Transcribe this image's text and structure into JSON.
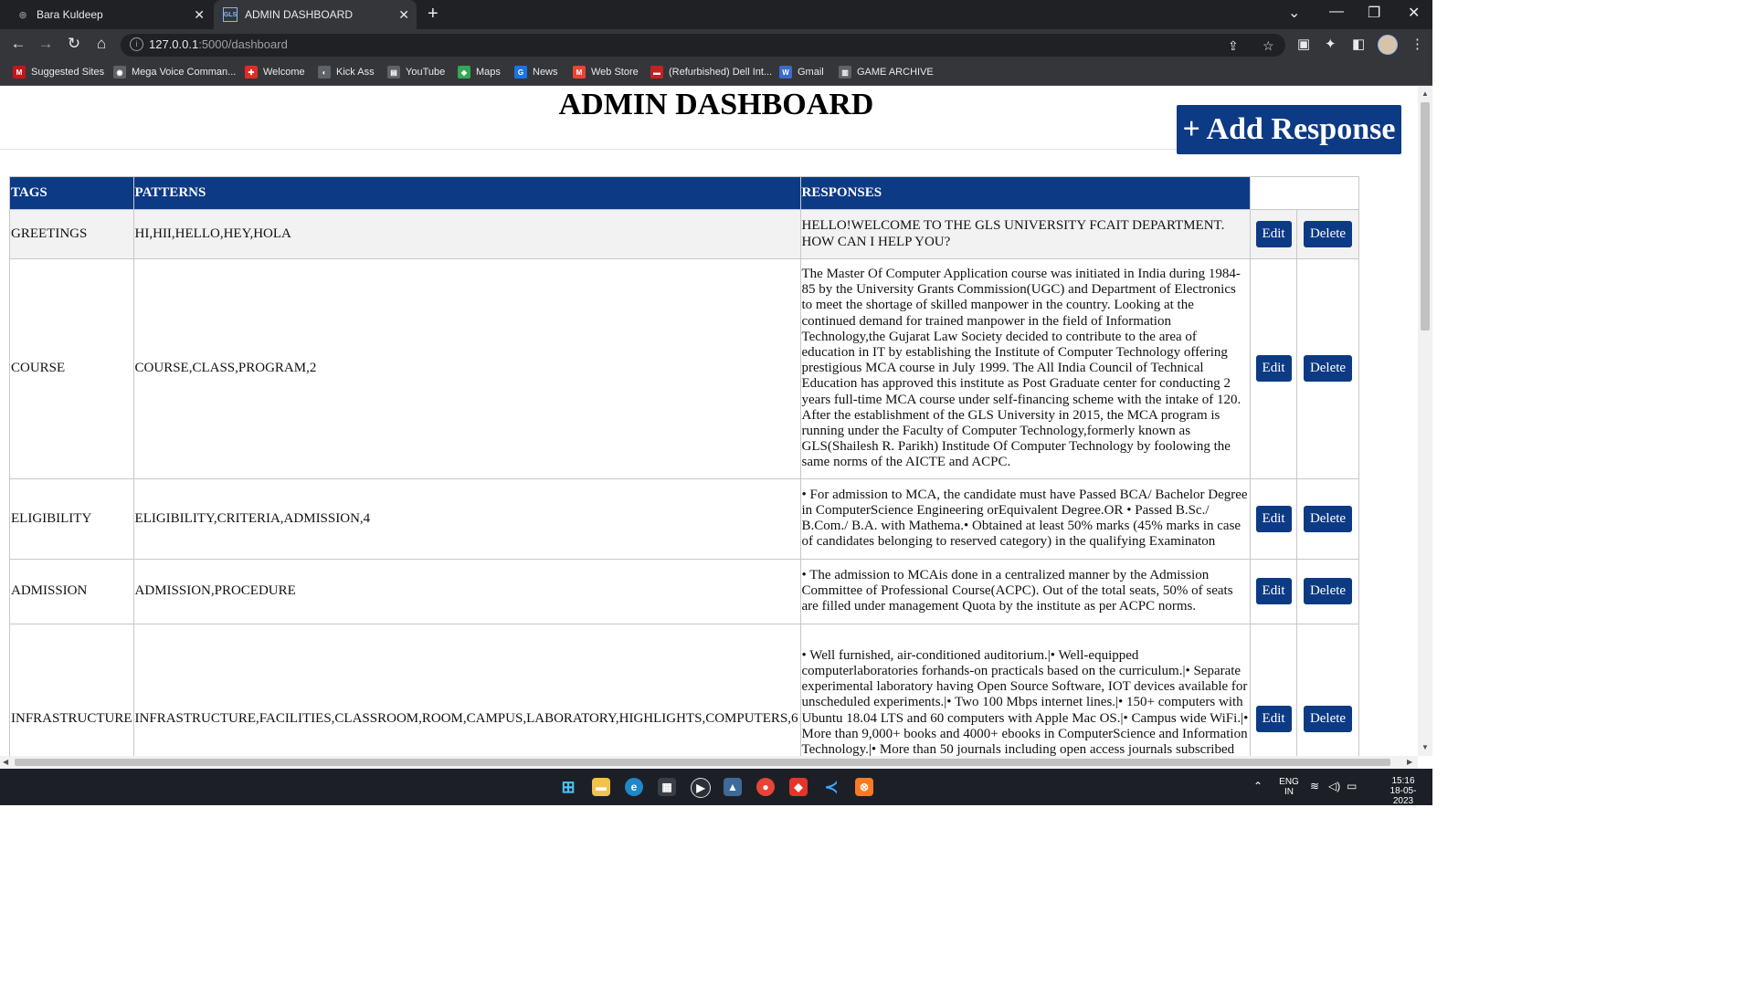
{
  "browser": {
    "tabs": [
      {
        "title": "Bara Kuldeep",
        "active": false
      },
      {
        "title": "ADMIN DASHBOARD",
        "active": true,
        "favicon": "GLS"
      }
    ],
    "url": {
      "host": "127.0.0.1",
      "rest": ":5000/dashboard"
    },
    "bookmarks": [
      {
        "label": "Suggested Sites",
        "icon": "M",
        "color": "#c4161c"
      },
      {
        "label": "Mega Voice Comman...",
        "icon": "◉",
        "color": "#5f6368"
      },
      {
        "label": "Welcome",
        "icon": "✚",
        "color": "#d93025"
      },
      {
        "label": "Kick Ass",
        "icon": "◐",
        "color": "#5f6368"
      },
      {
        "label": "YouTube",
        "icon": "▤",
        "color": "#5f6368"
      },
      {
        "label": "Maps",
        "icon": "◆",
        "color": "#34a853"
      },
      {
        "label": "News",
        "icon": "G",
        "color": "#1a73e8"
      },
      {
        "label": "Web Store",
        "icon": "M",
        "color": "#ea4335"
      },
      {
        "label": "(Refurbished) Dell Int...",
        "icon": "▬",
        "color": "#c5221f"
      },
      {
        "label": "Gmail",
        "icon": "W",
        "color": "#3c6bc8"
      },
      {
        "label": "GAME ARCHIVE",
        "icon": "▥",
        "color": "#5f6368"
      }
    ]
  },
  "page": {
    "title": "ADMIN DASHBOARD",
    "add_button": "+ Add Response",
    "table": {
      "headers": [
        "TAGS",
        "PATTERNS",
        "RESPONSES"
      ],
      "edit_label": "Edit",
      "delete_label": "Delete",
      "rows": [
        {
          "tag": "GREETINGS",
          "patterns": "HI,HII,HELLO,HEY,HOLA",
          "response": "HELLO!WELCOME TO THE GLS UNIVERSITY FCAIT DEPARTMENT. HOW CAN I HELP YOU?"
        },
        {
          "tag": "COURSE",
          "patterns": "COURSE,CLASS,PROGRAM,2",
          "response": "The Master Of Computer Application course was initiated in India during 1984-85 by the University Grants Commission(UGC) and Department of Electronics to meet the shortage of skilled manpower in the country. Looking at the continued demand for trained manpower in the field of Information Technology,the Gujarat Law Society decided to contribute to the area of education in IT by establishing the Institute of Computer Technology offering prestigious MCA course in July 1999. The All India Council of Technical Education has approved this institute as Post Graduate center for conducting 2 years full-time MCA course under self-financing scheme with the intake of 120. After the establishment of the GLS University in 2015, the MCA program is running under the Faculty of Computer Technology,formerly known as GLS(Shailesh R. Parikh) Institude Of Computer Technology by foolowing the same norms of the AICTE and ACPC."
        },
        {
          "tag": "ELIGIBILITY",
          "patterns": "ELIGIBILITY,CRITERIA,ADMISSION,4",
          "response": "• For admission to MCA, the candidate must have Passed BCA/ Bachelor Degree in ComputerScience Engineering orEquivalent Degree.OR • Passed B.Sc./ B.Com./ B.A. with Mathema.• Obtained at least 50% marks (45% marks in case of candidates belonging to reserved category) in the qualifying Examinaton"
        },
        {
          "tag": "ADMISSION",
          "patterns": "ADMISSION,PROCEDURE",
          "response": "• The admission to MCAis done in a centralized manner by the Admission Committee of Professional Course(ACPC). Out of the total seats, 50% of seats are filled under management Quota by the institute as per ACPC norms."
        },
        {
          "tag": "INFRASTRUCTURE",
          "patterns": "INFRASTRUCTURE,FACILITIES,CLASSROOM,ROOM,CAMPUS,LABORATORY,HIGHLIGHTS,COMPUTERS,6",
          "response": "• Well furnished, air-conditioned auditorium.|• Well-equipped computerlaboratories forhands-on practicals based on the curriculum.|• Separate experimental laboratory having Open Source Software, IOT devices available for unscheduled experiments.|• Two 100 Mbps internet lines.|• 150+ computers with Ubuntu 18.04 LTS and 60 computers with Apple Mac OS.|• Campus wide WiFi.|• More than 9,000+ books and 4000+ ebooks in ComputerScience and Information Technology.|• More than 50 journals including open access journals subscribed on ComputerScience and related subjects.|• An air-conditioned and spacious reading room on the premises of the library.|• The institute provides residence"
        }
      ]
    }
  },
  "taskbar": {
    "lang_top": "ENG",
    "lang_bottom": "IN",
    "time": "15:16",
    "date": "18-05-2023"
  }
}
